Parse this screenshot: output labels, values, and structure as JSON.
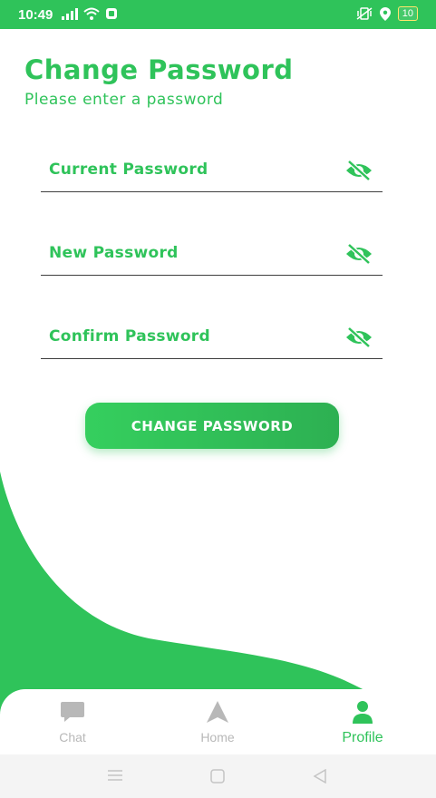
{
  "status_bar": {
    "time": "10:49",
    "battery": "10",
    "icons": [
      "signal-icon",
      "wifi-icon",
      "notification-icon",
      "vibrate-icon",
      "location-icon",
      "battery-icon"
    ]
  },
  "page": {
    "title": "Change Password",
    "subtitle": "Please enter a password"
  },
  "form": {
    "fields": [
      {
        "label": "Current Password",
        "icon": "eye-off-icon"
      },
      {
        "label": "New Password",
        "icon": "eye-off-icon"
      },
      {
        "label": "Confirm Password",
        "icon": "eye-off-icon"
      }
    ],
    "submit_label": "CHANGE PASSWORD"
  },
  "bottom_nav": {
    "items": [
      {
        "label": "Chat",
        "icon": "chat-icon",
        "active": false
      },
      {
        "label": "Home",
        "icon": "navigation-arrow-icon",
        "active": false
      },
      {
        "label": "Profile",
        "icon": "person-icon",
        "active": true
      }
    ]
  },
  "colors": {
    "accent": "#2fc35a",
    "inactive": "#b8b8b8",
    "underline": "#3f3f3f"
  }
}
